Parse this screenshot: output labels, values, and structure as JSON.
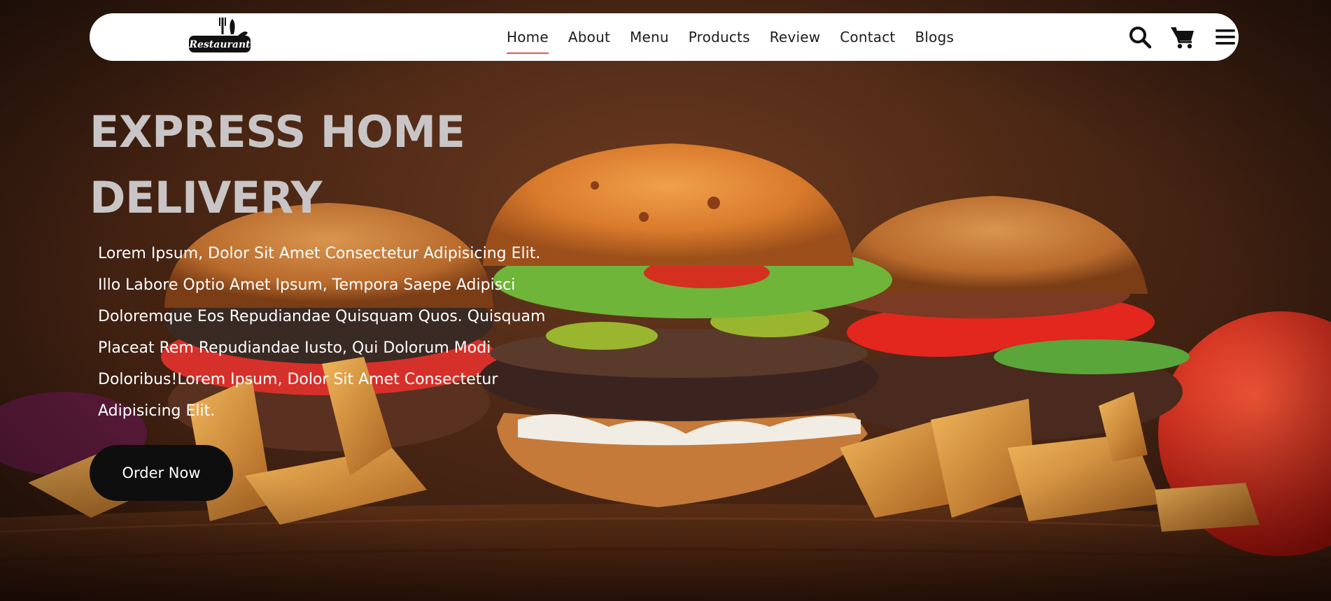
{
  "navbar": {
    "logo_text": "Restaurant",
    "links": [
      {
        "label": "Home",
        "active": true
      },
      {
        "label": "About",
        "active": false
      },
      {
        "label": "Menu",
        "active": false
      },
      {
        "label": "Products",
        "active": false
      },
      {
        "label": "Review",
        "active": false
      },
      {
        "label": "Contact",
        "active": false
      },
      {
        "label": "Blogs",
        "active": false
      }
    ],
    "icons": [
      "search-icon",
      "cart-icon",
      "menu-icon"
    ],
    "active_underline_color": "#e8555a"
  },
  "hero": {
    "headline_lines": [
      "EXPRESS HOME",
      "DELIVERY"
    ],
    "paragraph_lines": [
      "Lorem Ipsum, Dolor Sit Amet Consectetur Adipisicing Elit.",
      "Illo Labore Optio Amet Ipsum, Tempora Saepe Adipisci",
      "Doloremque Eos Repudiandae Quisquam Quos. Quisquam",
      "Placeat Rem Repudiandae Iusto, Qui Dolorum Modi",
      "Doloribus!Lorem Ipsum, Dolor Sit Amet Consectetur",
      "Adipisicing Elit."
    ],
    "cta_label": "Order Now",
    "background_image": "burgers-and-fries-on-wooden-board"
  },
  "colors": {
    "navbar_bg": "#ffffff",
    "headline": "#c9c5c6",
    "button_bg": "#0e0e0e",
    "button_text": "#ffffff"
  }
}
